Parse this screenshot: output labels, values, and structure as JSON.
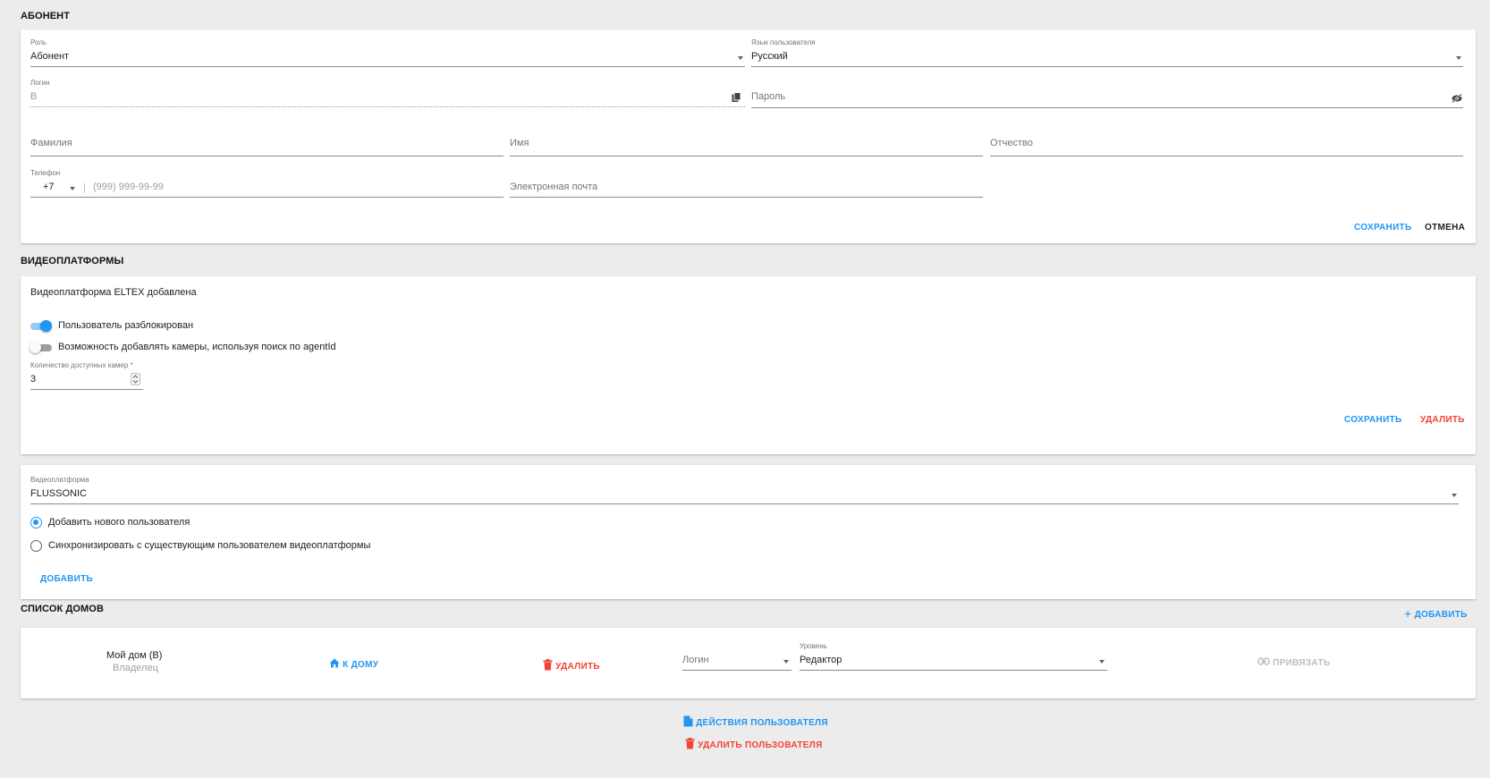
{
  "subscriber": {
    "title": "АБОНЕНТ",
    "role": {
      "label": "Роль",
      "value": "Абонент"
    },
    "language": {
      "label": "Язык пользователя",
      "value": "Русский"
    },
    "login": {
      "label": "Логин",
      "value": "В"
    },
    "password": {
      "placeholder": "Пароль"
    },
    "last_name": {
      "placeholder": "Фамилия"
    },
    "first_name": {
      "placeholder": "Имя"
    },
    "middle_name": {
      "placeholder": "Отчество"
    },
    "phone": {
      "label": "Телефон",
      "code": "+7",
      "placeholder": "(999) 999-99-99"
    },
    "email": {
      "placeholder": "Электронная почта"
    },
    "save_label": "СОХРАНИТЬ",
    "cancel_label": "ОТМЕНА"
  },
  "videoplatforms": {
    "title": "ВИДЕОПЛАТФОРМЫ",
    "eltex": {
      "heading": "Видеоплатформа ELTEX добавлена",
      "user_unblocked": {
        "label": "Пользователь разблокирован",
        "on": true
      },
      "agent_search": {
        "label": "Возможность добавлять камеры, используя поиск по agentId",
        "on": false
      },
      "camera_count": {
        "label": "Количество доступных камер *",
        "value": "3"
      },
      "save_label": "СОХРАНИТЬ",
      "delete_label": "УДАЛИТЬ"
    },
    "new_platform": {
      "select_label": "Видеоплатформа",
      "select_value": "FLUSSONIC",
      "radio_new": "Добавить нового пользователя",
      "radio_sync": "Синхронизировать с существующим пользователем видеоплатформы",
      "selected": "new",
      "add_label": "ДОБАВИТЬ"
    }
  },
  "houses": {
    "title": "СПИСОК ДОМОВ",
    "add_label": "ДОБАВИТЬ",
    "items": [
      {
        "name": "Мой дом (В)",
        "role": "Владелец",
        "to_house_label": "К ДОМУ",
        "delete_label": "УДАЛИТЬ",
        "login_placeholder": "Логин",
        "level_label": "Уровень",
        "level_value": "Редактор",
        "bind_label": "ПРИВЯЗАТЬ"
      }
    ]
  },
  "footer": {
    "user_actions_label": "ДЕЙСТВИЯ ПОЛЬЗОВАТЕЛЯ",
    "delete_user_label": "УДАЛИТЬ ПОЛЬЗОВАТЕЛЯ"
  },
  "colors": {
    "accent": "#2196f3",
    "danger": "#f44336",
    "background": "#ececec"
  }
}
